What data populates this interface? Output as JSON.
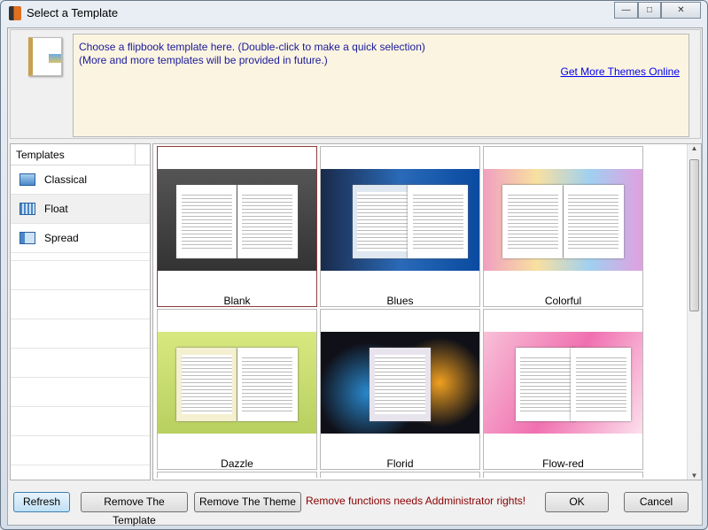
{
  "window": {
    "title": "Select a Template",
    "controls": [
      "minimize",
      "maximize",
      "close"
    ]
  },
  "info": {
    "line1": "Choose a flipbook template here. (Double-click to make a quick selection)",
    "line2": "(More and more templates will be provided in future.)",
    "link": "Get More Themes Online"
  },
  "sidebar": {
    "header": "Templates",
    "items": [
      {
        "label": "Classical"
      },
      {
        "label": "Float"
      },
      {
        "label": "Spread"
      }
    ]
  },
  "templates": [
    {
      "name": "Blank"
    },
    {
      "name": "Blues"
    },
    {
      "name": "Colorful"
    },
    {
      "name": "Dazzle"
    },
    {
      "name": "Florid"
    },
    {
      "name": "Flow-red"
    }
  ],
  "footer": {
    "refresh": "Refresh",
    "remove_template": "Remove The Template",
    "remove_theme": "Remove The Theme",
    "warning": "Remove functions needs Addministrator rights!",
    "ok": "OK",
    "cancel": "Cancel"
  }
}
